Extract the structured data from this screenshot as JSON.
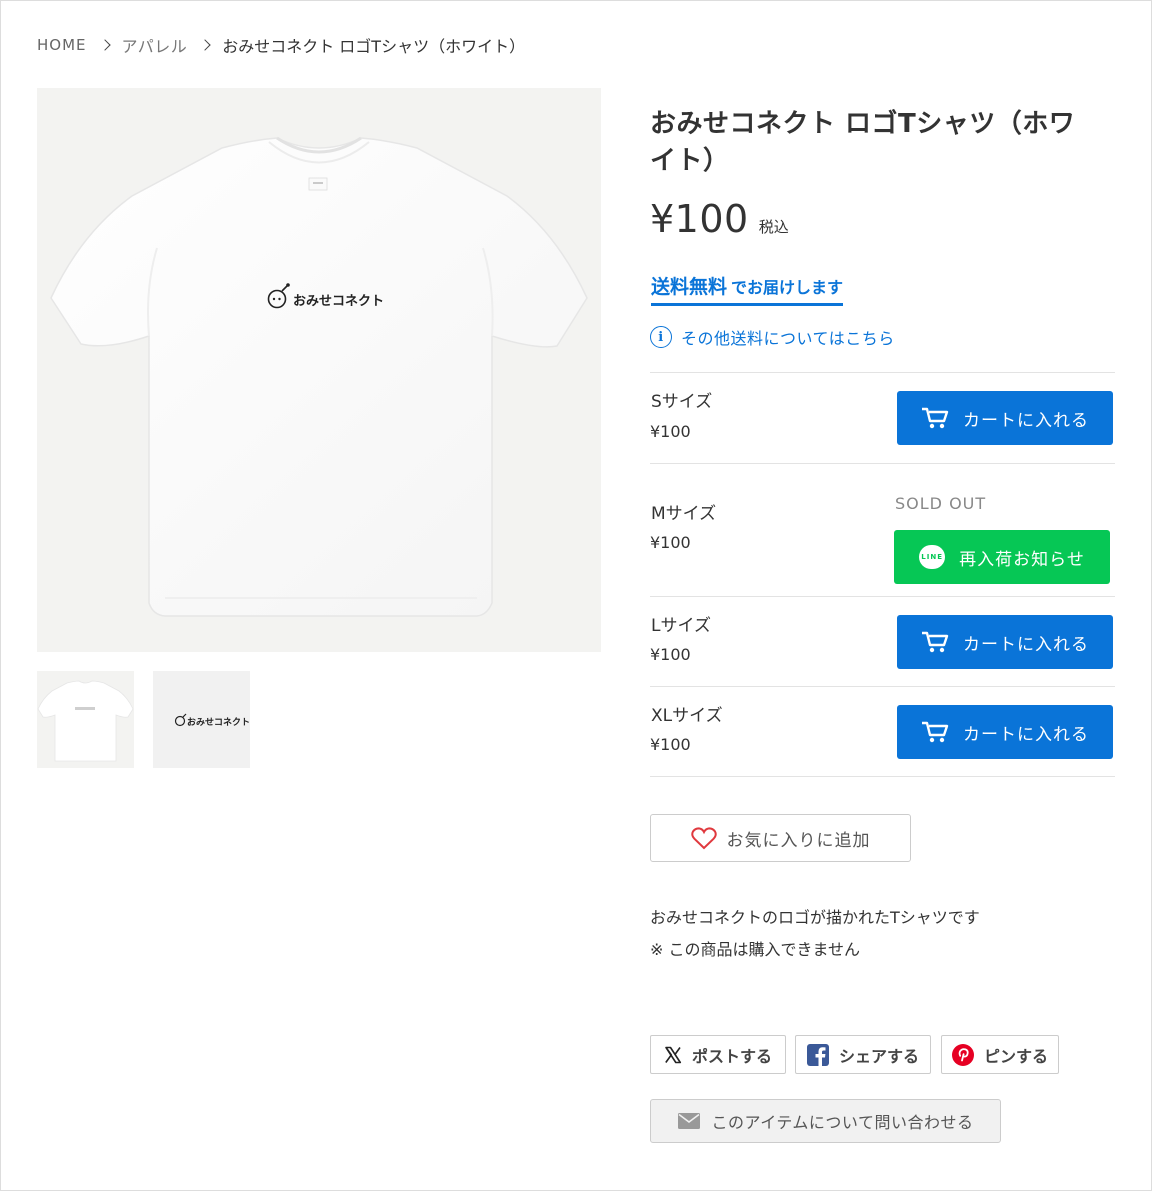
{
  "breadcrumb": {
    "home": "HOME",
    "category": "アパレル",
    "current": "おみせコネクト ロゴTシャツ（ホワイト）"
  },
  "product": {
    "title": "おみせコネクト ロゴTシャツ（ホワイト）",
    "price": "¥100",
    "tax_label": "税込",
    "free_shipping_strong": "送料無料",
    "free_shipping_rest": "でお届けします",
    "shipping_link": "その他送料についてはこちら",
    "print_logo": "おみせコネクト",
    "description_line1": "おみせコネクトのロゴが描かれたTシャツです",
    "description_line2": "※ この商品は購入できません"
  },
  "variants": [
    {
      "name": "Sサイズ",
      "price": "¥100",
      "action": "カートに入れる"
    },
    {
      "name": "Mサイズ",
      "price": "¥100",
      "status": "SOLD OUT",
      "action": "再入荷お知らせ"
    },
    {
      "name": "Lサイズ",
      "price": "¥100",
      "action": "カートに入れる"
    },
    {
      "name": "XLサイズ",
      "price": "¥100",
      "action": "カートに入れる"
    }
  ],
  "line_badge": "LINE",
  "favorite_label": "お気に入りに追加",
  "share": {
    "x": "ポストする",
    "facebook": "シェアする",
    "pinterest": "ピンする"
  },
  "contact_label": "このアイテムについて問い合わせる",
  "colors": {
    "primary": "#0a74d8",
    "line_green": "#06c755",
    "heart_red": "#e0393e"
  }
}
